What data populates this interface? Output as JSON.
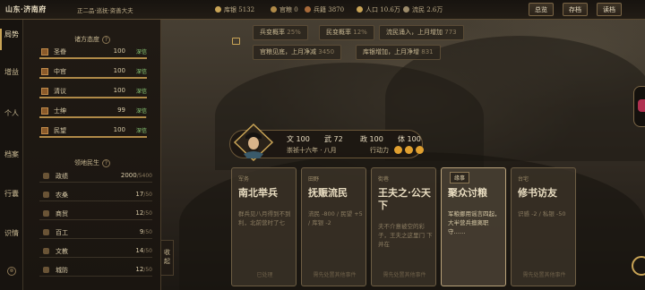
{
  "topbar": {
    "region": "山东·济南府",
    "rank": "正二品·巡抚·资善大夫",
    "resources": [
      {
        "icon": "coin-icon",
        "label": "库银",
        "value": "5132",
        "color": "#c9a456"
      },
      {
        "icon": "grain-icon",
        "label": "官粮",
        "value": "0",
        "color": "#b08a48"
      },
      {
        "icon": "soldier-icon",
        "label": "兵籍",
        "value": "3870",
        "color": "#a86a3a"
      },
      {
        "icon": "people-icon",
        "label": "人口",
        "value": "10.6万",
        "color": "#c9a456"
      },
      {
        "icon": "refugee-icon",
        "label": "流民",
        "value": "2.6万",
        "color": "#9c8b6a"
      }
    ],
    "buttons": {
      "overview": "总览",
      "save": "存档",
      "load": "读档"
    }
  },
  "nav": {
    "tabs": [
      "局势",
      "增益",
      "个人",
      "档案",
      "行囊",
      "识情"
    ]
  },
  "panel": {
    "stance_title": "诸方态度",
    "stances": [
      {
        "name": "圣眷",
        "value": "100",
        "tag": "深信",
        "pct": 100
      },
      {
        "name": "中官",
        "value": "100",
        "tag": "深信",
        "pct": 100
      },
      {
        "name": "清议",
        "value": "100",
        "tag": "深信",
        "pct": 100
      },
      {
        "name": "士绅",
        "value": "99",
        "tag": "深信",
        "pct": 99
      },
      {
        "name": "民望",
        "value": "100",
        "tag": "深信",
        "pct": 100
      }
    ],
    "dev_title": "领地民生",
    "devs": [
      {
        "name": "政绩",
        "value": "2000",
        "max": "/5400"
      },
      {
        "name": "农桑",
        "value": "17",
        "max": "/50"
      },
      {
        "name": "商贸",
        "value": "12",
        "max": "/50"
      },
      {
        "name": "百工",
        "value": "9",
        "max": "/50"
      },
      {
        "name": "文教",
        "value": "14",
        "max": "/50"
      },
      {
        "name": "城防",
        "value": "12",
        "max": "/50"
      }
    ],
    "collapse": "收起"
  },
  "chips": [
    {
      "label": "兵变概率",
      "value": "25%"
    },
    {
      "label": "民变概率",
      "value": "12%"
    },
    {
      "label": "流民涌入，上月增加",
      "value": "773"
    },
    {
      "label": "官粮见底，上月净减",
      "value": "3450"
    },
    {
      "label": "库银增加，上月净增",
      "value": "831"
    }
  ],
  "character": {
    "wen_label": "文",
    "wen": "100",
    "wu_label": "武",
    "wu": "72",
    "zheng_label": "政",
    "zheng": "100",
    "ti_label": "体",
    "ti": "100",
    "date": "崇祯十六年 · 八月",
    "ap_label": "行动力",
    "ap_colors": [
      "#e0a030",
      "#e0a030",
      "#e0a030"
    ]
  },
  "cards": [
    {
      "cat": "军务",
      "title": "南北举兵",
      "desc": "群兵见八月得到不到利，北前营时了七",
      "foot": "已处理"
    },
    {
      "cat": "田野",
      "title": "抚赈流民",
      "desc": "流民 -800 / 民望 +5 / 库银 -2",
      "foot": "需先处置其他事件"
    },
    {
      "cat": "街巷",
      "title": "王夫之·公天下",
      "desc": "夫不介意被空的彩子，王夫之这里门 下并在",
      "foot": "需先处置其他事件"
    },
    {
      "cat": "缘事",
      "title": "聚众讨粮",
      "desc": "军粮挪用谣言四起，大半营兵擅离职守……",
      "foot": ""
    },
    {
      "cat": "台宅",
      "title": "修书访友",
      "desc": "识感 -2 / 私银 -50",
      "foot": "需先处置其他事件"
    }
  ]
}
